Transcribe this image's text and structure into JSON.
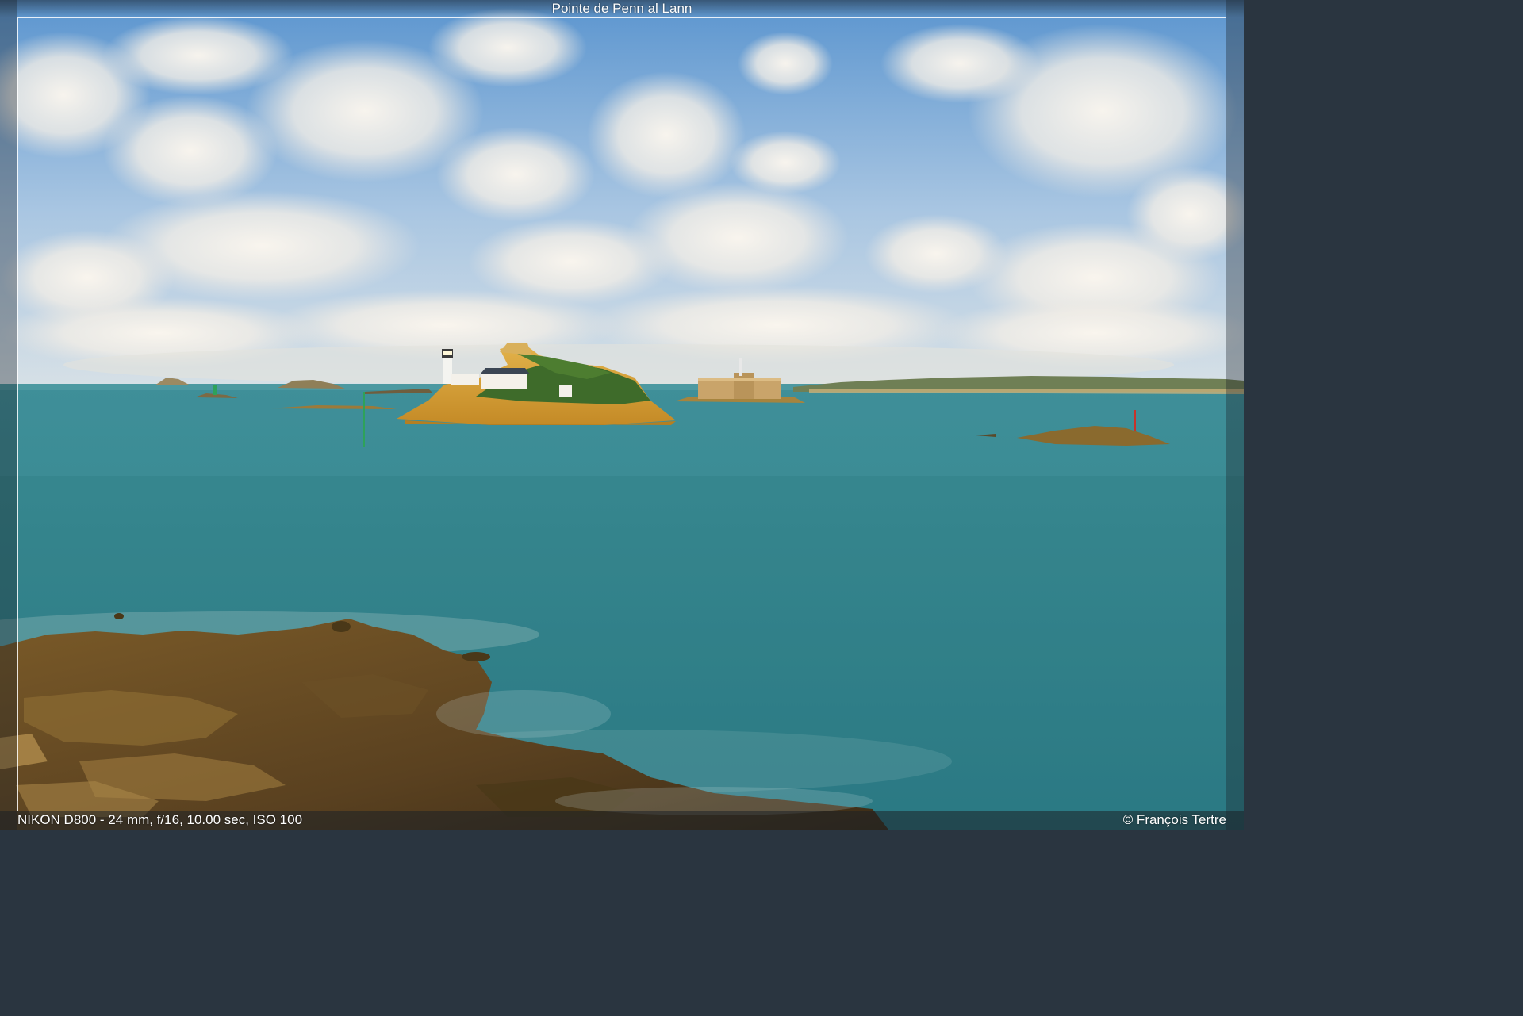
{
  "photo": {
    "title": "Pointe de Penn al Lann",
    "exif": "NIKON D800 - 24 mm, f/16, 10.00 sec, ISO 100",
    "credit": "© François Tertre"
  },
  "colors": {
    "sky_top": "#6fa6d8",
    "sky_horizon": "#c9d8e6",
    "sea_near": "#2f7e86",
    "sea_far": "#3f9aa3",
    "rock_sunlit": "#d9a23a",
    "rock_dark": "#5b4420",
    "vegetation": "#3e6b2a",
    "fort_stone": "#c9a46a"
  }
}
